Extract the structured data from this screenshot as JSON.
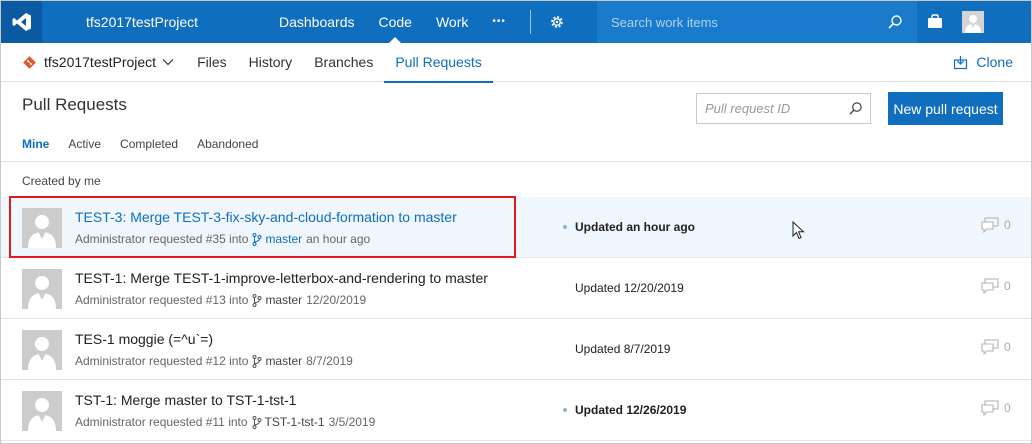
{
  "topbar": {
    "project": "tfs2017testProject",
    "nav": [
      {
        "label": "Dashboards",
        "active": false
      },
      {
        "label": "Code",
        "active": true
      },
      {
        "label": "Work",
        "active": false
      }
    ],
    "more": "•••",
    "search_placeholder": "Search work items",
    "accent": "#106ebe"
  },
  "subbar": {
    "repo": "tfs2017testProject",
    "nav": [
      {
        "label": "Files",
        "active": false
      },
      {
        "label": "History",
        "active": false
      },
      {
        "label": "Branches",
        "active": false
      },
      {
        "label": "Pull Requests",
        "active": true
      }
    ],
    "clone": "Clone"
  },
  "page": {
    "title": "Pull Requests",
    "search_placeholder": "Pull request ID",
    "new_button": "New pull request",
    "tabs": [
      {
        "label": "Mine",
        "active": true
      },
      {
        "label": "Active",
        "active": false
      },
      {
        "label": "Completed",
        "active": false
      },
      {
        "label": "Abandoned",
        "active": false
      }
    ],
    "section": "Created by me"
  },
  "pull_requests": [
    {
      "title": "TEST-3: Merge TEST-3-fix-sky-and-cloud-formation to master",
      "requested": "Administrator requested #35 into",
      "branch": "master",
      "when": "an hour ago",
      "status": "Updated an hour ago",
      "comments": "0"
    },
    {
      "title": "TEST-1: Merge TEST-1-improve-letterbox-and-rendering to master",
      "requested": "Administrator requested #13 into",
      "branch": "master",
      "when": "12/20/2019",
      "status": "Updated 12/20/2019",
      "comments": "0"
    },
    {
      "title": "TES-1 moggie (=^u`=)",
      "requested": "Administrator requested #12 into",
      "branch": "master",
      "when": "8/7/2019",
      "status": "Updated 8/7/2019",
      "comments": "0"
    },
    {
      "title": "TST-1: Merge master to TST-1-tst-1",
      "requested": "Administrator requested #11 into",
      "branch": "TST-1-tst-1",
      "when": "3/5/2019",
      "status": "Updated 12/26/2019",
      "comments": "0"
    }
  ],
  "icons": [
    "vs-logo-icon",
    "more-icon",
    "gear-icon",
    "search-icon",
    "bag-icon",
    "git-repo-icon",
    "chevron-down-icon",
    "clone-icon",
    "branch-icon",
    "comment-icon",
    "mouse-cursor-icon"
  ]
}
